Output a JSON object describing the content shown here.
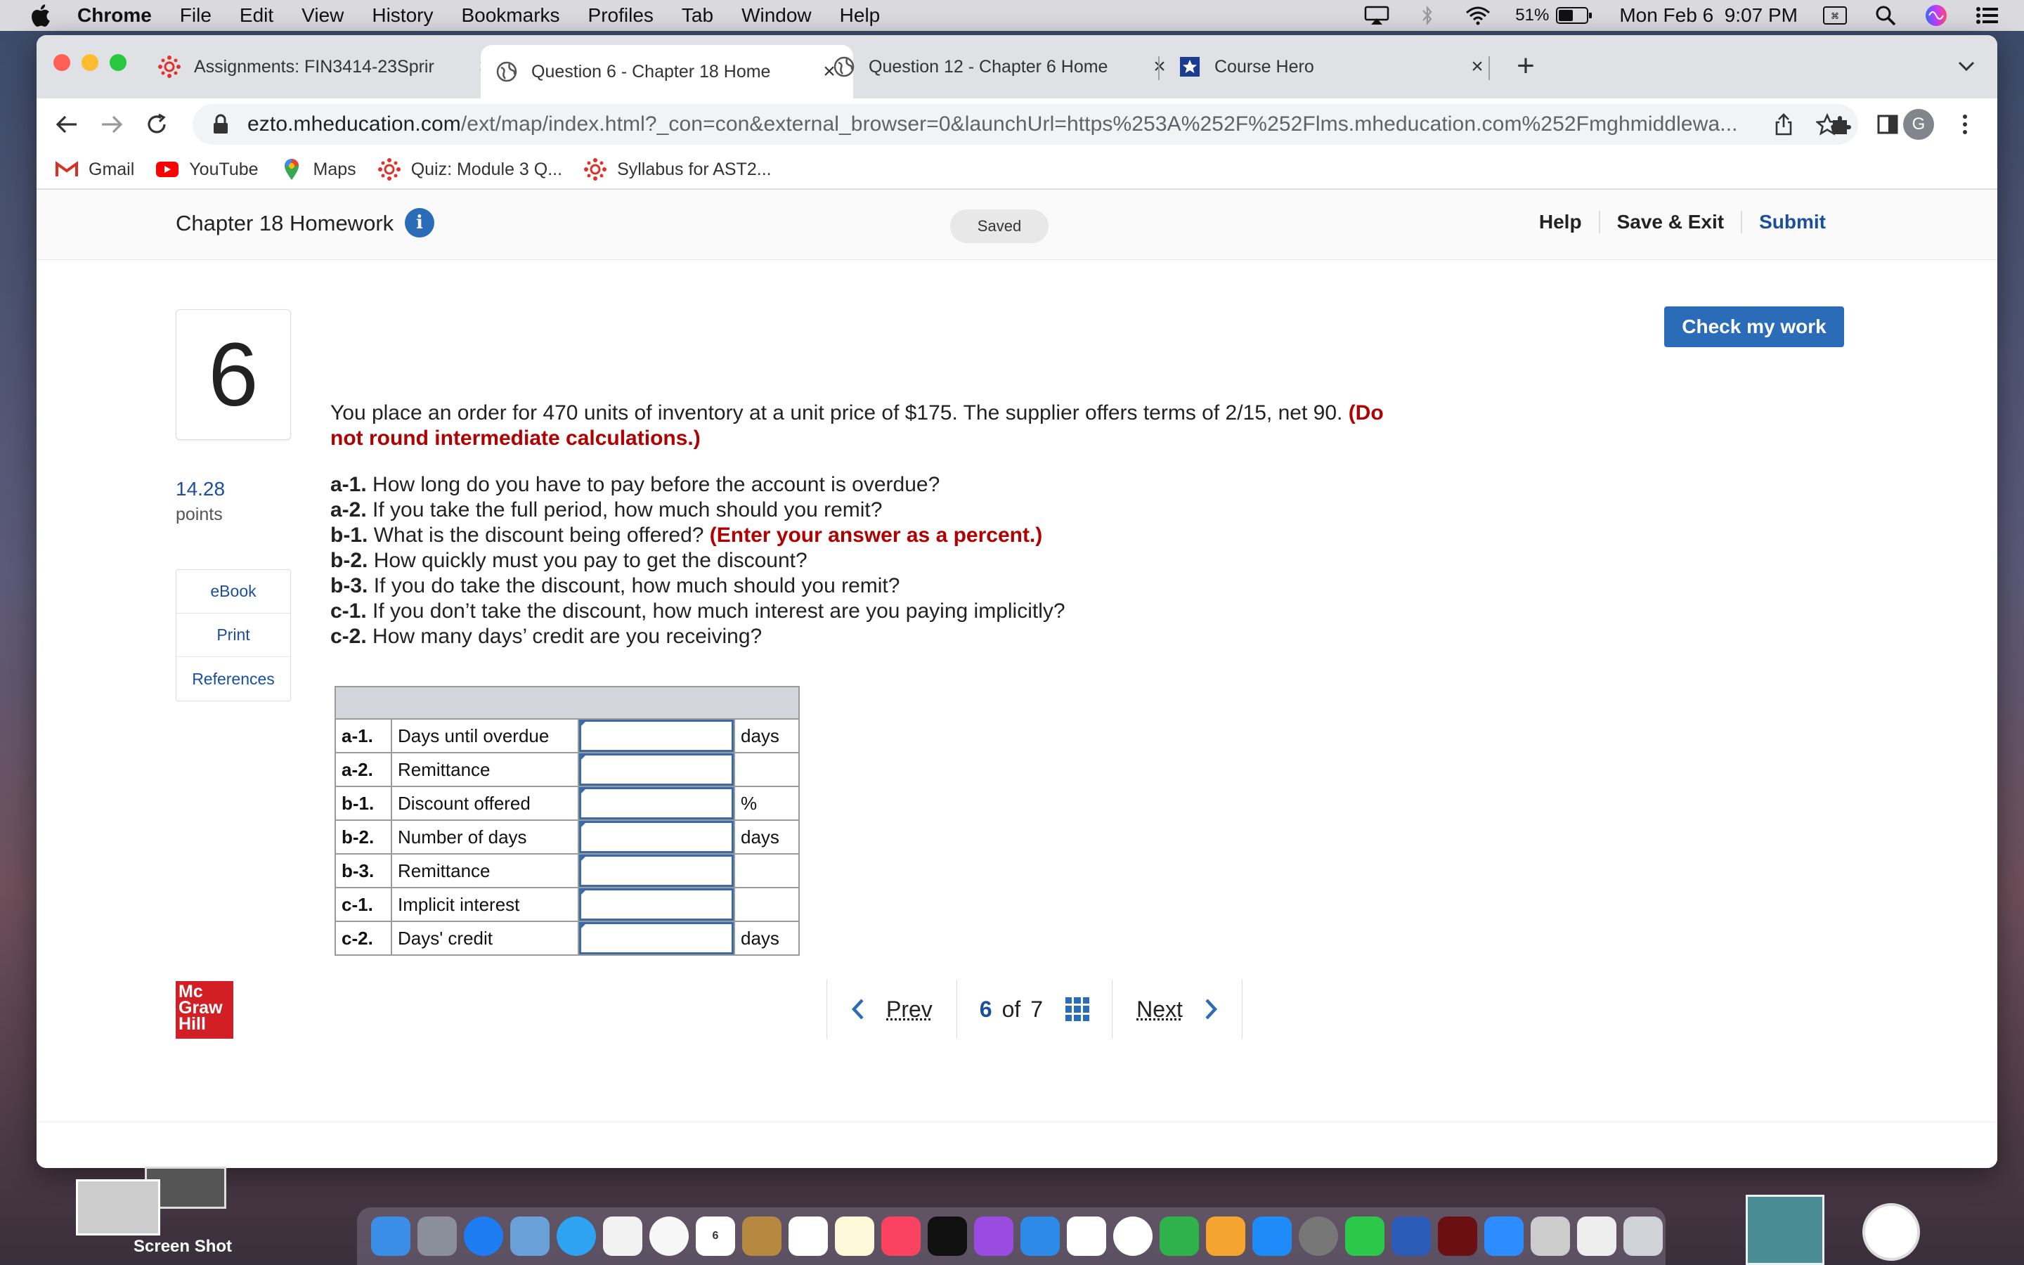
{
  "menubar": {
    "app": "Chrome",
    "items": [
      "File",
      "Edit",
      "View",
      "History",
      "Bookmarks",
      "Profiles",
      "Tab",
      "Window",
      "Help"
    ],
    "battery": "51%",
    "datetime": "Mon Feb 6  9:07 PM"
  },
  "tabs": [
    {
      "title": "Assignments: FIN3414-23Sprir",
      "active": false
    },
    {
      "title": "Question 6 - Chapter 18 Home",
      "active": true
    },
    {
      "title": "Question 12 - Chapter 6 Home",
      "active": false
    },
    {
      "title": "Course Hero",
      "active": false
    }
  ],
  "toolbar": {
    "url_host": "ezto.mheducation.com",
    "url_path": "/ext/map/index.html?_con=con&external_browser=0&launchUrl=https%253A%252F%252Flms.mheducation.com%252Fmghmiddlewa...",
    "avatar": "G"
  },
  "bookmarks": [
    "Gmail",
    "YouTube",
    "Maps",
    "Quiz: Module 3 Q...",
    "Syllabus for AST2..."
  ],
  "header": {
    "title": "Chapter 18 Homework",
    "info": "i",
    "saved": "Saved",
    "help": "Help",
    "save_exit": "Save & Exit",
    "submit": "Submit"
  },
  "check_button": "Check my work",
  "question": {
    "number": "6",
    "points": "14.28",
    "points_label": "points",
    "side_links": [
      "eBook",
      "Print",
      "References"
    ],
    "text": "You place an order for 470 units of inventory at a unit price of $175. The supplier offers terms of 2/15, net 90.",
    "text_note": "(Do not round intermediate calculations.)",
    "parts": [
      {
        "label": "a-1.",
        "text": "How long do you have to pay before the account is overdue?",
        "note": ""
      },
      {
        "label": "a-2.",
        "text": "If you take the full period, how much should you remit?",
        "note": ""
      },
      {
        "label": "b-1.",
        "text": "What is the discount being offered?",
        "note": "(Enter your answer as a percent.)"
      },
      {
        "label": "b-2.",
        "text": "How quickly must you pay to get the discount?",
        "note": ""
      },
      {
        "label": "b-3.",
        "text": "If you do take the discount, how much should you remit?",
        "note": ""
      },
      {
        "label": "c-1.",
        "text": "If you don’t take the discount, how much interest are you paying implicitly?",
        "note": ""
      },
      {
        "label": "c-2.",
        "text": "How many days’ credit are you receiving?",
        "note": ""
      }
    ]
  },
  "answer_table": [
    {
      "label": "a-1.",
      "desc": "Days until overdue",
      "value": "",
      "unit": "days"
    },
    {
      "label": "a-2.",
      "desc": "Remittance",
      "value": "",
      "unit": ""
    },
    {
      "label": "b-1.",
      "desc": "Discount offered",
      "value": "",
      "unit": "%"
    },
    {
      "label": "b-2.",
      "desc": "Number of days",
      "value": "",
      "unit": "days"
    },
    {
      "label": "b-3.",
      "desc": "Remittance",
      "value": "",
      "unit": ""
    },
    {
      "label": "c-1.",
      "desc": "Implicit interest",
      "value": "",
      "unit": ""
    },
    {
      "label": "c-2.",
      "desc": "Days' credit",
      "value": "",
      "unit": "days"
    }
  ],
  "footer": {
    "logo_line1": "Mc",
    "logo_line2": "Graw",
    "logo_line3": "Hill",
    "prev": "Prev",
    "current": "6",
    "of": "of",
    "total": "7",
    "next": "Next"
  },
  "desktop": {
    "screenshot_label": "Screen Shot"
  },
  "colors": {
    "accent": "#2b6cb8",
    "submit": "#1a4f9c",
    "note_red": "#b00000",
    "logo_red": "#d21f26"
  }
}
